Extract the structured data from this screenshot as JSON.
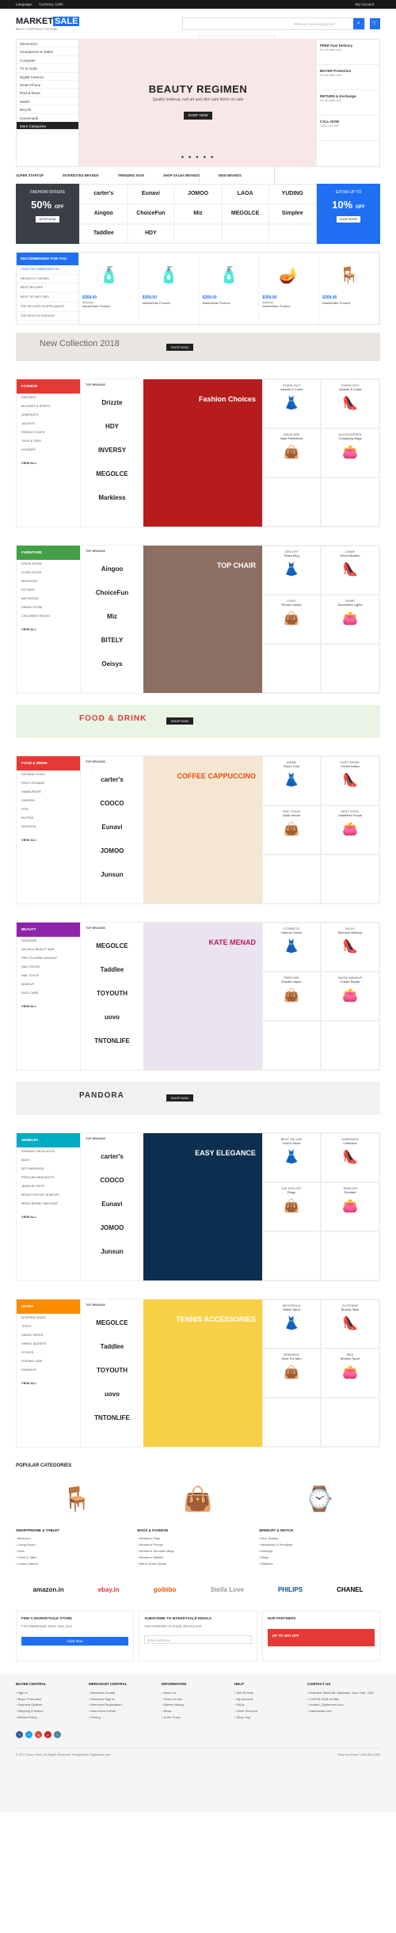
{
  "topbar": {
    "language": "Language:",
    "currency": "Currency: USD",
    "account": "My Account"
  },
  "logo": {
    "brand": "MARKET",
    "brand2": "SALE",
    "tagline": "BEAUTY SHOPPING AT THE HOME"
  },
  "search": {
    "category": "All Categories",
    "placeholder": "What are you looking for?"
  },
  "categories": [
    "Electronics",
    "Smartphone & Tablet",
    "Computer",
    "TV & Audio",
    "Digital Camera",
    "Smart Phone",
    "iPod & Music",
    "Watch",
    "Bicycle",
    "Homemade",
    "More Categories"
  ],
  "slider": {
    "title": "BEAUTY REGIMEN",
    "sub": "Quality makeup, nail art and skin care items on sale",
    "shop": "SHOP NOW"
  },
  "services": [
    {
      "t": "FREE Fast Delivery",
      "s": "For all order over"
    },
    {
      "t": "BUYER Protection",
      "s": "For all order over"
    },
    {
      "t": "RETURN & Exchange",
      "s": "For all order over"
    },
    {
      "t": "CALL NOW",
      "s": "1-800-123-456"
    }
  ],
  "tabs": [
    "SUPER STARTUP",
    "INTERESTED BRANDS",
    "TRENDING NOW",
    "SHOP SALEA BRANDS",
    "NEW BRANDS"
  ],
  "promo_left": {
    "label": "FASHION OFFERS",
    "pct": "50%",
    "off": "OFF",
    "btn": "SHOP NOW"
  },
  "promo_right": {
    "label": "EXTRA UP TO",
    "pct": "10%",
    "off": "OFF",
    "btn": "SHOP MORE"
  },
  "brands": [
    "carter's",
    "Eunavi",
    "JOMOO",
    "LAOA",
    "YUDING",
    "Aingoo",
    "ChoiceFun",
    "Miz",
    "MEGOLCE",
    "Simplee",
    "Taddlee",
    "HDY"
  ],
  "recommend": {
    "title": "RECOMMENDED FOR YOU",
    "items": [
      "YOUR RECOMMENDATION",
      "RECENTLY VIEWED",
      "BEST SELLERS",
      "BEST OF WATCHES",
      "TOP SELLERS IN APPLIANCES",
      "TOP PICKS IN FASHION"
    ]
  },
  "products": [
    {
      "p": "$359.00",
      "o": "$380.00",
      "n": "MarketSale Product"
    },
    {
      "p": "$359.00",
      "o": "",
      "n": "MarketSale Product"
    },
    {
      "p": "$359.00",
      "o": "",
      "n": "MarketSale Product"
    },
    {
      "p": "$359.00",
      "o": "$380.00",
      "n": "MarketSale Product"
    },
    {
      "p": "$359.00",
      "o": "",
      "n": "MarketSale Product"
    }
  ],
  "banner1": {
    "title": "New Collection 2018",
    "btn": "SHOP NOW"
  },
  "cats": [
    {
      "name": "FASHION",
      "color": "#e53935",
      "links": [
        "DRESSES",
        "BLOUSES & SHIRTS",
        "JUMPSUITS",
        "JACKETS",
        "FRENCH COATS",
        "TOPS & TEES",
        "HOODIES"
      ],
      "brands": [
        "Drizzte",
        "HDY",
        "INVERSY",
        "MEGOLCE",
        "Markless"
      ],
      "hero": "Fashion Choices",
      "tiles": [
        [
          "STAND OUT",
          "Jackets & Coats"
        ],
        [
          "STAND OUT",
          "Jackets & Coats"
        ],
        [
          "DAVID WEI",
          "Style Redefined"
        ],
        [
          "ACCESSORIES",
          "Crossbody Bags"
        ],
        [
          "",
          ""
        ],
        [
          "",
          ""
        ]
      ]
    },
    {
      "name": "FURNITURE",
      "color": "#43a047",
      "links": [
        "SPACE ROOM",
        "LIVING ROOM",
        "BEDROOM",
        "KITCHEN",
        "BATHROOM",
        "DINING ROOM",
        "CHILDREN'S ROOM"
      ],
      "brands": [
        "Aingoo",
        "ChoiceFun",
        "Miz",
        "BITELY",
        "Oeisys"
      ],
      "hero": "TOP CHAIR",
      "tiles": [
        [
          "25% OFF",
          "Glass Mug"
        ],
        [
          "CHAIR",
          "Wood Modern"
        ],
        [
          "LIGHT",
          "Round Lamps"
        ],
        [
          "HOME",
          "Decorative Lights"
        ],
        [
          "",
          ""
        ],
        [
          "",
          ""
        ]
      ]
    },
    {
      "name": "FOOD & DRINK",
      "color": "#e53935",
      "links": [
        "ORGANIC FOOD",
        "FRUIT ORGANIC",
        "HAMBURGER",
        "CHICKEN",
        "FISH",
        "BUTTER",
        "SEAFOOD"
      ],
      "brands": [
        "carter's",
        "COOCO",
        "Eunavi",
        "JOMOO",
        "Junsun"
      ],
      "hero": "COFFEE CAPPUCCINO",
      "tiles": [
        [
          "DRINK",
          "Room Cool"
        ],
        [
          "SOFT DRINK",
          "Cream Italian"
        ],
        [
          "FAST FOOD",
          "Garlic Bread"
        ],
        [
          "FAST FOOD",
          "Smithfield Foods"
        ],
        [
          "",
          ""
        ],
        [
          "",
          ""
        ]
      ]
    },
    {
      "name": "BEAUTY",
      "color": "#8e24aa",
      "links": [
        "SKINCARE",
        "SALON & BEAUTY BAR",
        "PRE-COLORED MAKEUP",
        "NAIL POLISH",
        "NAIL TOOLS",
        "MAKEUP",
        "FACE CARE"
      ],
      "brands": [
        "MEGOLCE",
        "Taddlee",
        "TOYOUTH",
        "uovo",
        "TNTONLIFE"
      ],
      "hero": "KATE MENAD",
      "tiles": [
        [
          "COSMETIC",
          "Natural Cream"
        ],
        [
          "VICHY",
          "Skincare Makeup"
        ],
        [
          "PERFUME",
          "Eravilla Japan"
        ],
        [
          "SNOW MAKEUP",
          "Cream Repair"
        ],
        [
          "",
          ""
        ],
        [
          "",
          ""
        ]
      ]
    },
    {
      "name": "JEWELRY",
      "color": "#00acc1",
      "links": [
        "PENDANT NECKLACES",
        "BAGS",
        "SET EARRINGS",
        "POPULAR BRACELETS",
        "JEWELRY SETS",
        "BEADS FOR DIY JEWELRY",
        "MEN'S BRAND WATCHES"
      ],
      "brands": [
        "carter's",
        "COOCO",
        "Eunavi",
        "JOMOO",
        "Junsun"
      ],
      "hero": "EASY ELEGANCE",
      "tiles": [
        [
          "BEST SELLER",
          "Gold & Silver"
        ],
        [
          "EARRINGS",
          "Collection"
        ],
        [
          "14K 10% OFF",
          "Rings"
        ],
        [
          "JEWELRY",
          "Pendant"
        ],
        [
          "",
          ""
        ],
        [
          "",
          ""
        ]
      ]
    },
    {
      "name": "SPORT",
      "color": "#fb8c00",
      "links": [
        "SLEEPING BAGS",
        "TENTS",
        "HIKING SHOES",
        "HIKING JACKETS",
        "STOVES",
        "FISHING LURE",
        "SWIMSUIT"
      ],
      "brands": [
        "MEGOLCE",
        "Taddlee",
        "TOYOUTH",
        "uovo",
        "TNTONLIFE"
      ],
      "hero": "TENNIS ACCESSORIES",
      "tiles": [
        [
          "MOTOROLA",
          "Watch Sport"
        ],
        [
          "CLOTHING",
          "Beauty Style"
        ],
        [
          "REBOKEN",
          "Shoe For Men"
        ],
        [
          "BRA",
          "Women Sport"
        ],
        [
          "",
          ""
        ],
        [
          "",
          ""
        ]
      ]
    }
  ],
  "foodbanner": {
    "title": "FOOD & DRINK",
    "btn": "SHOP NOW"
  },
  "pandora": {
    "title": "PANDORA",
    "btn": "SHOP NOW"
  },
  "popular": {
    "title": "POPULAR CATEGORIES",
    "cols": [
      {
        "t": "SMARTPHONE & TABLET",
        "i": [
          "Bedroom",
          "Living Room",
          "Sofa",
          "Chair & Table",
          "Luxury Interior"
        ]
      },
      {
        "t": "BAGS & FASHION",
        "i": [
          "Women's Flats",
          "Women's Pumps",
          "Women's Shoulder Bags",
          "Women's Wallets",
          "Men's Dress Shoes"
        ]
      },
      {
        "t": "JEWELRY & WATCH",
        "i": [
          "Fine Jewelry",
          "Necklaces & Pendants",
          "Earrings",
          "Rings",
          "Watches"
        ]
      }
    ]
  },
  "logos": [
    "amazon.in",
    "ebay.in",
    "goibibo",
    "Stella Love",
    "PHILIPS",
    "CHANEL"
  ],
  "boxes": {
    "find": {
      "t": "FIND A MARKETSALE STORE",
      "s": "Find Marketsale Store near you!",
      "btn": "Click here"
    },
    "sub": {
      "t": "SUBSCRIBE TO MARKETSALE EMAILS",
      "s": "Get newsletter is simply dummy text",
      "ph": "Email address"
    },
    "partner": {
      "t": "OUR PARTNERS",
      "s": "UP TO 30% OFF"
    }
  },
  "footer": {
    "cols": [
      {
        "t": "BUYER CENTRAL",
        "i": [
          "Sign In",
          "Buyer Protection",
          "Payment Options",
          "Shipping & Return",
          "Refund Policy"
        ]
      },
      {
        "t": "MERCHANT CENTRAL",
        "i": [
          "Merchant Central",
          "Merchant Sign In",
          "Merchant Registration",
          "How Does it Work",
          "Pricing"
        ]
      },
      {
        "t": "INFORMATION",
        "i": [
          "About Us",
          "Terms of Use",
          "Market History",
          "News",
          "In the Press"
        ]
      },
      {
        "t": "HELP",
        "i": [
          "Sell All Help",
          "My Account",
          "FAQs",
          "Other Services",
          "Shop Hop"
        ]
      },
      {
        "t": "CONTACT US",
        "i": [
          "Example Street 68, Mahattan, New York, USA",
          "(+0079) 2418 94 666",
          "contact_1@themes.com",
          "marketsale.com"
        ]
      }
    ],
    "copyright": "© 2017 Demo Store. All Rights Reserved. Designed by Tcgthemes.com",
    "shopby": "Shop by phone 1-800-302-2369"
  }
}
